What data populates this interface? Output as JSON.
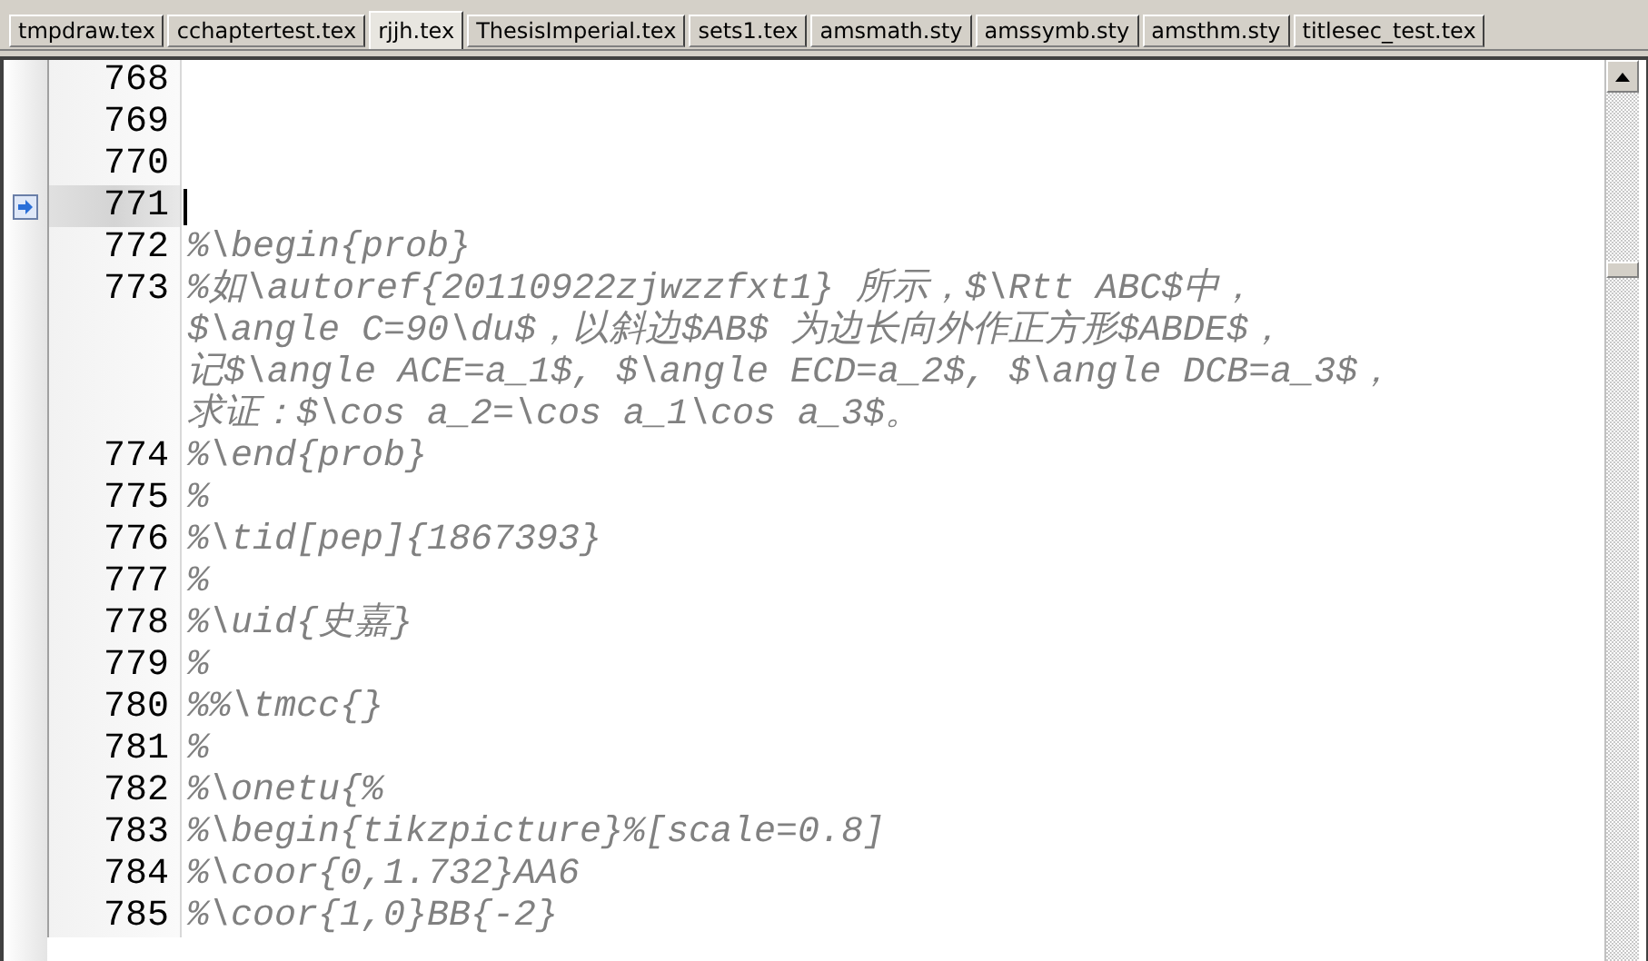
{
  "tabs": [
    {
      "label": "tmpdraw.tex",
      "selected": false
    },
    {
      "label": "cchaptertest.tex",
      "selected": false
    },
    {
      "label": "rjjh.tex",
      "selected": true
    },
    {
      "label": "ThesisImperial.tex",
      "selected": false
    },
    {
      "label": "sets1.tex",
      "selected": false
    },
    {
      "label": "amsmath.sty",
      "selected": false
    },
    {
      "label": "amssymb.sty",
      "selected": false
    },
    {
      "label": "amsthm.sty",
      "selected": false
    },
    {
      "label": "titlesec_test.tex",
      "selected": false
    }
  ],
  "editor": {
    "lines": [
      {
        "number": "768",
        "current": false,
        "bookmark": false
      },
      {
        "number": "769",
        "current": false,
        "bookmark": false
      },
      {
        "number": "770",
        "current": false,
        "bookmark": false
      },
      {
        "number": "771",
        "current": true,
        "bookmark": true
      },
      {
        "number": "772",
        "current": false,
        "bookmark": false,
        "text": [
          "%\\begin{prob}"
        ]
      },
      {
        "number": "773",
        "current": false,
        "bookmark": false,
        "text": [
          "%如\\autoref{20110922zjwzzfxt1} 所示，$\\Rtt ABC$中，",
          "$\\angle C=90\\du$，以斜边$AB$ 为边长向外作正方形$ABDE$，",
          "记$\\angle ACE=a_1$, $\\angle ECD=a_2$, $\\angle DCB=a_3$，",
          "求证：$\\cos a_2=\\cos a_1\\cos a_3$。"
        ]
      },
      {
        "number": "774",
        "current": false,
        "bookmark": false,
        "text": [
          "%\\end{prob}"
        ]
      },
      {
        "number": "775",
        "current": false,
        "bookmark": false,
        "text": [
          "%"
        ]
      },
      {
        "number": "776",
        "current": false,
        "bookmark": false,
        "text": [
          "%\\tid[pep]{1867393}"
        ]
      },
      {
        "number": "777",
        "current": false,
        "bookmark": false,
        "text": [
          "%"
        ]
      },
      {
        "number": "778",
        "current": false,
        "bookmark": false,
        "text": [
          "%\\uid{史嘉}"
        ]
      },
      {
        "number": "779",
        "current": false,
        "bookmark": false,
        "text": [
          "%"
        ]
      },
      {
        "number": "780",
        "current": false,
        "bookmark": false,
        "text": [
          "%%\\tmcc{}"
        ]
      },
      {
        "number": "781",
        "current": false,
        "bookmark": false,
        "text": [
          "%"
        ]
      },
      {
        "number": "782",
        "current": false,
        "bookmark": false,
        "text": [
          "%\\onetu{%"
        ]
      },
      {
        "number": "783",
        "current": false,
        "bookmark": false,
        "text": [
          "%\\begin{tikzpicture}%[scale=0.8]"
        ]
      },
      {
        "number": "784",
        "current": false,
        "bookmark": false,
        "text": [
          "%\\coor{0,1.732}AA6"
        ]
      },
      {
        "number": "785",
        "current": false,
        "bookmark": false,
        "text": [
          "%\\coor{1,0}BB{-2}"
        ]
      }
    ]
  }
}
